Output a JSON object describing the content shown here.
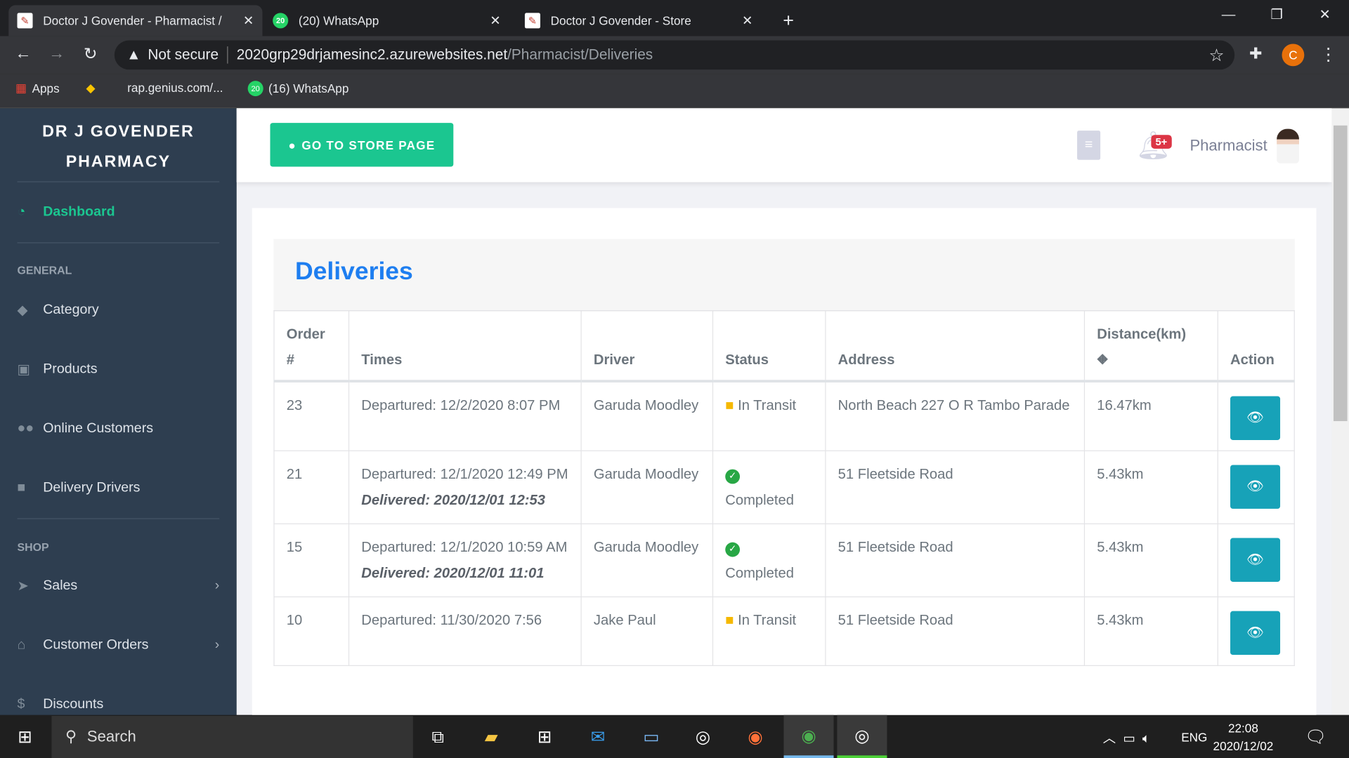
{
  "browser": {
    "tabs": [
      {
        "title": "Doctor J Govender - Pharmacist / ",
        "active": true
      },
      {
        "title": "(20) WhatsApp",
        "badge": "20",
        "active": false
      },
      {
        "title": "Doctor J Govender - Store",
        "active": false
      }
    ],
    "security": "Not secure",
    "url_host": "2020grp29drjamesinc2.azurewebsites.net",
    "url_path": "/Pharmacist/Deliveries",
    "profile_initial": "C",
    "bookmarks": [
      {
        "label": "Apps"
      },
      {
        "label": "rap.genius.com/..."
      },
      {
        "label": "(16) WhatsApp",
        "badge": "20"
      }
    ]
  },
  "sidebar": {
    "brand_line1": "DR J GOVENDER",
    "brand_line2": "PHARMACY",
    "dashboard": "Dashboard",
    "sections": {
      "general": "GENERAL",
      "shop": "SHOP"
    },
    "general_items": [
      {
        "label": "Category",
        "icon": "tags-icon"
      },
      {
        "label": "Products",
        "icon": "medkit-icon"
      },
      {
        "label": "Online Customers",
        "icon": "users-icon"
      },
      {
        "label": "Delivery Drivers",
        "icon": "truck-icon"
      }
    ],
    "shop_items": [
      {
        "label": "Sales",
        "icon": "paper-plane-icon"
      },
      {
        "label": "Customer Orders",
        "icon": "basket-icon"
      },
      {
        "label": "Discounts",
        "icon": "dollar-icon"
      }
    ]
  },
  "header": {
    "store_button": "GO TO STORE PAGE",
    "notif_badge": "5+",
    "user_role": "Pharmacist"
  },
  "page": {
    "title": "Deliveries"
  },
  "table": {
    "headers": {
      "order_1": "Order",
      "order_2": "#",
      "times": "Times",
      "driver": "Driver",
      "status": "Status",
      "address": "Address",
      "distance": "Distance(km)",
      "action": "Action"
    },
    "rows": [
      {
        "order": "23",
        "departed": "Departured: 12/2/2020 8:07 PM",
        "delivered": "",
        "driver": "Garuda Moodley",
        "status": "In Transit",
        "address": "North Beach 227 O R Tambo Parade",
        "distance": "16.47km"
      },
      {
        "order": "21",
        "departed": "Departured: 12/1/2020 12:49 PM",
        "delivered": "Delivered: 2020/12/01 12:53",
        "driver": "Garuda Moodley",
        "status": "Completed",
        "address": "51 Fleetside Road",
        "distance": "5.43km"
      },
      {
        "order": "15",
        "departed": "Departured: 12/1/2020 10:59 AM",
        "delivered": "Delivered: 2020/12/01 11:01",
        "driver": "Garuda Moodley",
        "status": "Completed",
        "address": "51 Fleetside Road",
        "distance": "5.43km"
      },
      {
        "order": "10",
        "departed": "Departured: 11/30/2020 7:56",
        "delivered": "",
        "driver": "Jake Paul",
        "status": "In Transit",
        "address": "51 Fleetside Road",
        "distance": "5.43km"
      }
    ]
  },
  "taskbar": {
    "search": "Search",
    "lang": "ENG",
    "time": "22:08",
    "date": "2020/12/02"
  },
  "colors": {
    "sidebar": "#2e3e50",
    "accent_green": "#1bc690",
    "title_blue": "#1e7ef0",
    "action": "#17a2b8",
    "badge": "#dc3545"
  }
}
